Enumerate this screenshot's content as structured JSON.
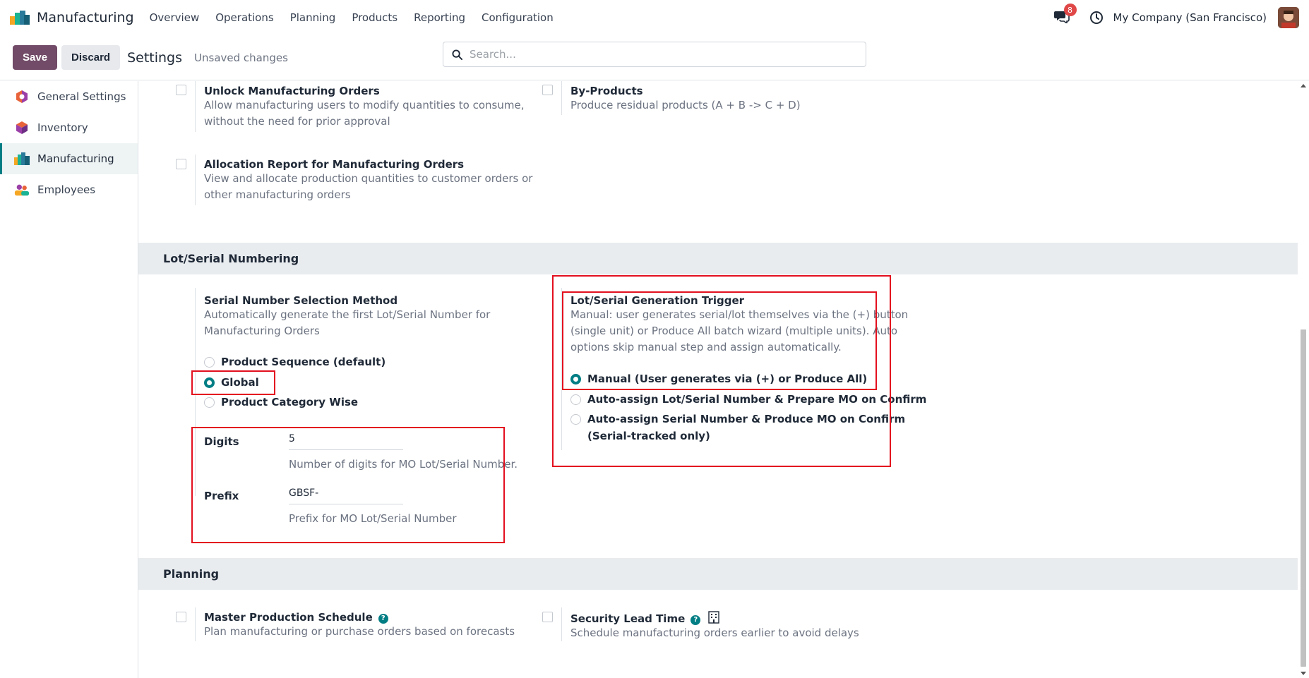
{
  "topnav": {
    "app_name": "Manufacturing",
    "menu": [
      "Overview",
      "Operations",
      "Planning",
      "Products",
      "Reporting",
      "Configuration"
    ],
    "chat_badge": "8",
    "company": "My Company (San Francisco)"
  },
  "control": {
    "save_label": "Save",
    "discard_label": "Discard",
    "title": "Settings",
    "status": "Unsaved changes",
    "search_placeholder": "Search..."
  },
  "sidebar": {
    "items": [
      {
        "label": "General Settings",
        "icon": "general-settings-icon"
      },
      {
        "label": "Inventory",
        "icon": "inventory-icon"
      },
      {
        "label": "Manufacturing",
        "icon": "manufacturing-icon",
        "active": true
      },
      {
        "label": "Employees",
        "icon": "employees-icon"
      }
    ]
  },
  "operations": {
    "unlock_mo": {
      "title": "Unlock Manufacturing Orders",
      "desc1": "Allow manufacturing users to modify quantities to consume,",
      "desc2": "without the need for prior approval",
      "checked": false
    },
    "by_products": {
      "title": "By-Products",
      "desc": "Produce residual products (A + B -> C + D)",
      "checked": false
    },
    "allocation": {
      "title": "Allocation Report for Manufacturing Orders",
      "desc1": "View and allocate production quantities to customer orders or",
      "desc2": "other manufacturing orders",
      "checked": false
    }
  },
  "lot_serial": {
    "section_title": "Lot/Serial Numbering",
    "selection_method": {
      "title": "Serial Number Selection Method",
      "desc1": "Automatically generate the first Lot/Serial Number for",
      "desc2": "Manufacturing Orders",
      "options": [
        "Product Sequence (default)",
        "Global",
        "Product Category Wise"
      ],
      "selected": "Global"
    },
    "digits": {
      "label": "Digits",
      "value": "5",
      "help": "Number of digits for MO Lot/Serial Number."
    },
    "prefix": {
      "label": "Prefix",
      "value": "GBSF-",
      "help": "Prefix for MO Lot/Serial Number"
    },
    "trigger": {
      "title": "Lot/Serial Generation Trigger",
      "desc1": "Manual: user generates serial/lot themselves via the (+) button",
      "desc2": "(single unit) or Produce All batch wizard (multiple units). Auto",
      "desc3": "options skip manual step and assign automatically.",
      "options": [
        "Manual (User generates via (+) or Produce All)",
        "Auto-assign Lot/Serial Number & Prepare MO on Confirm",
        "Auto-assign Serial Number & Produce MO on Confirm"
      ],
      "option3_line2": "(Serial-tracked only)",
      "selected": "Manual (User generates via (+) or Produce All)"
    }
  },
  "planning": {
    "section_title": "Planning",
    "mps": {
      "title": "Master Production Schedule",
      "desc": "Plan manufacturing or purchase orders based on forecasts",
      "checked": false
    },
    "lead_time": {
      "title": "Security Lead Time",
      "desc": "Schedule manufacturing orders earlier to avoid delays",
      "checked": false
    }
  },
  "colors": {
    "brand": "#714b67",
    "accent": "#017e84",
    "highlight": "#e3101f",
    "badge": "#e04848"
  }
}
